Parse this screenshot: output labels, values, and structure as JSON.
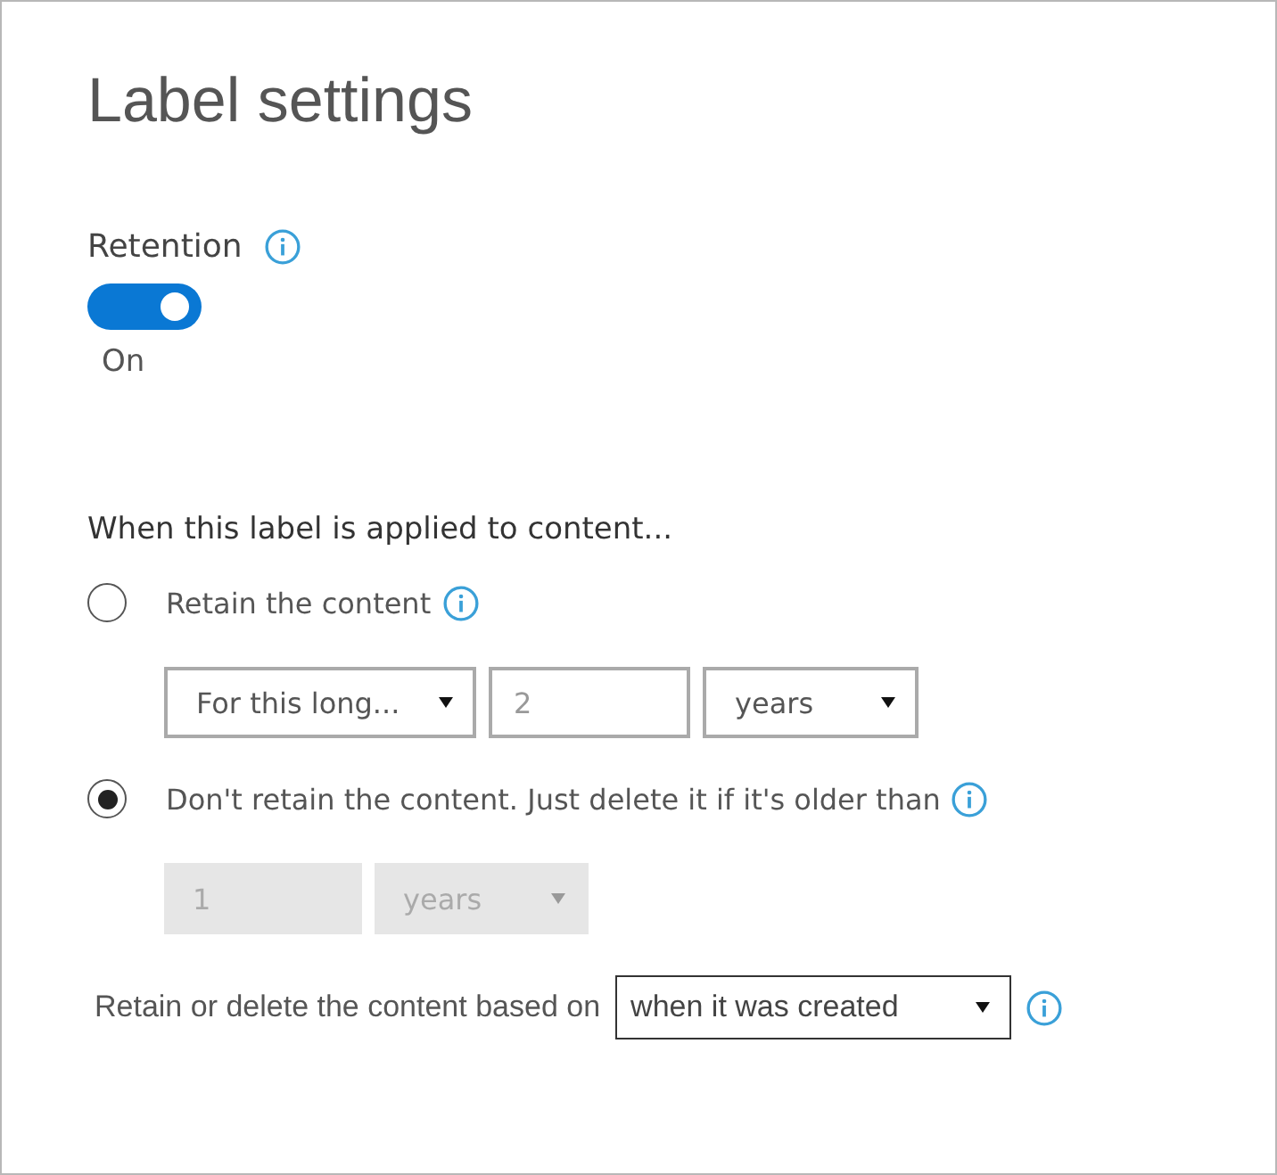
{
  "title": "Label settings",
  "retention": {
    "label": "Retention",
    "on": true,
    "state_text": "On"
  },
  "section_heading": "When this label is applied to content...",
  "options": [
    {
      "label": "Retain the content",
      "selected": false,
      "fields": [
        {
          "kind": "dropdown",
          "value": "For this long...",
          "disabled": false
        },
        {
          "kind": "input",
          "value": "2",
          "disabled": false
        },
        {
          "kind": "dropdown",
          "value": "years",
          "disabled": false
        }
      ]
    },
    {
      "label": "Don't retain the content. Just delete it if it's older than",
      "selected": true,
      "fields": [
        {
          "kind": "input",
          "value": "1",
          "disabled": true
        },
        {
          "kind": "dropdown",
          "value": "years",
          "disabled": true
        }
      ]
    }
  ],
  "based_on": {
    "label": "Retain or delete the content based on",
    "value": "when it was created"
  }
}
